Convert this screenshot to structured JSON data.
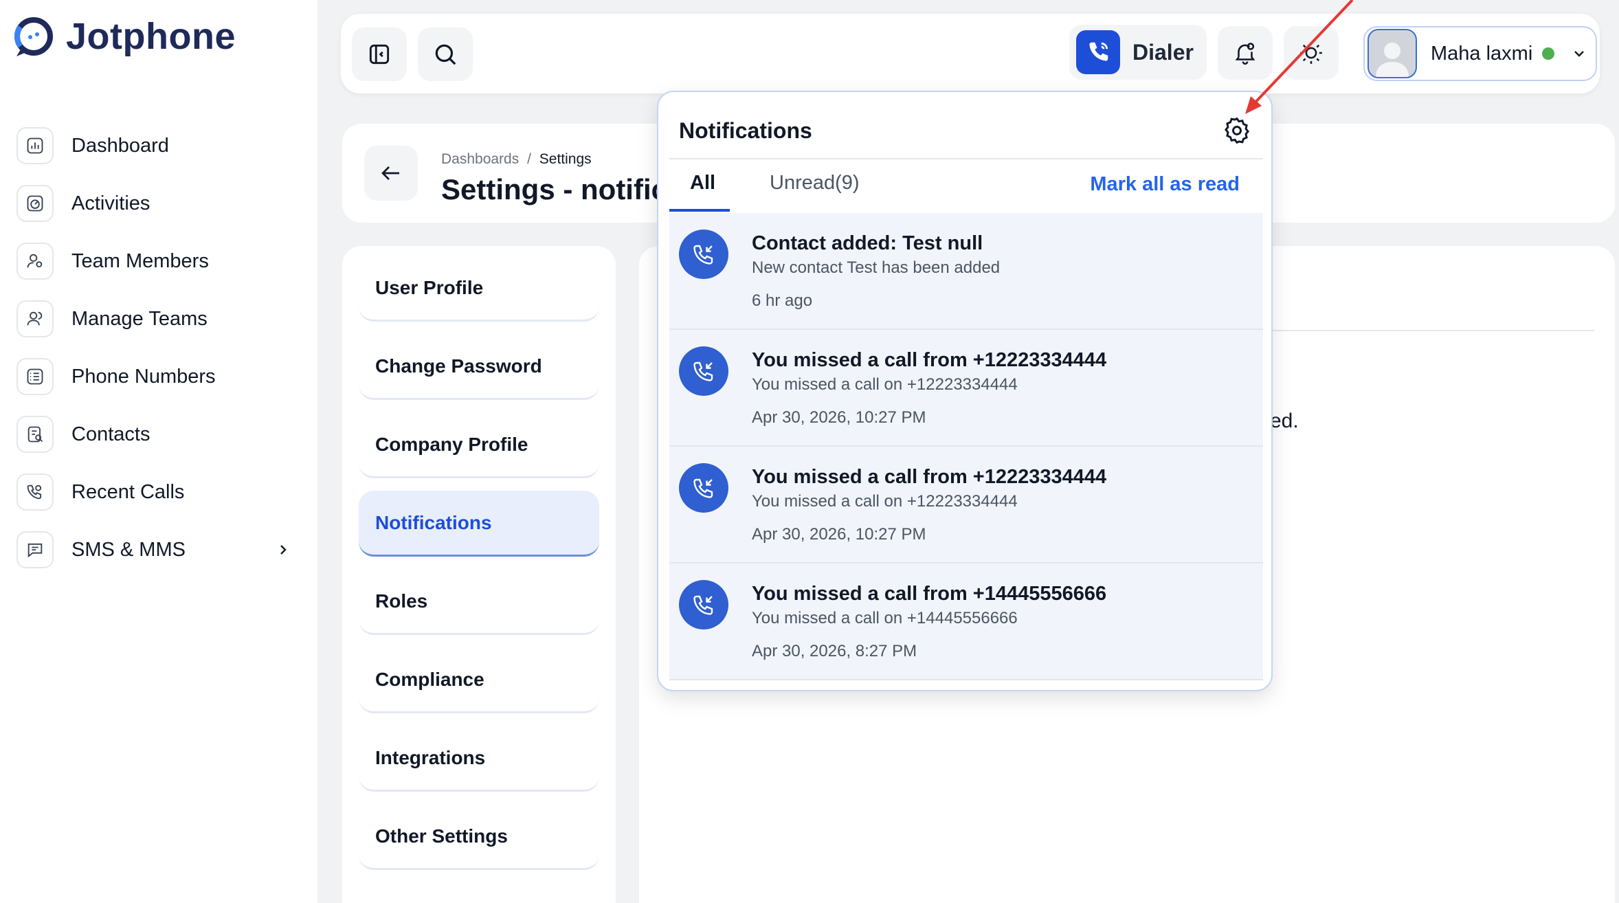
{
  "brand": {
    "name": "Jotphone"
  },
  "sidebar": {
    "items": [
      {
        "label": "Dashboard"
      },
      {
        "label": "Activities"
      },
      {
        "label": "Team Members"
      },
      {
        "label": "Manage Teams"
      },
      {
        "label": "Phone Numbers"
      },
      {
        "label": "Contacts"
      },
      {
        "label": "Recent Calls"
      },
      {
        "label": "SMS & MMS"
      }
    ]
  },
  "topbar": {
    "dialer_label": "Dialer",
    "user_name": "Maha laxmi",
    "status_color": "#4caf50"
  },
  "header": {
    "breadcrumb_root": "Dashboards",
    "breadcrumb_sep": "/",
    "breadcrumb_current": "Settings",
    "title": "Settings - notific"
  },
  "settings_menu": {
    "items": [
      {
        "label": "User Profile"
      },
      {
        "label": "Change Password"
      },
      {
        "label": "Company Profile"
      },
      {
        "label": "Notifications",
        "active": true
      },
      {
        "label": "Roles"
      },
      {
        "label": "Compliance"
      },
      {
        "label": "Integrations"
      },
      {
        "label": "Other Settings"
      }
    ]
  },
  "content": {
    "text_fragment": "ed."
  },
  "notifications": {
    "title": "Notifications",
    "tabs": {
      "all": "All",
      "unread": "Unread(9)"
    },
    "mark_all_label": "Mark all as read",
    "items": [
      {
        "title": "Contact added: Test null",
        "description": "New contact Test has been added",
        "time": "6 hr ago"
      },
      {
        "title": "You missed a call from +12223334444",
        "description": "You missed a call on +12223334444",
        "time": "Apr 30, 2026, 10:27 PM"
      },
      {
        "title": "You missed a call from +12223334444",
        "description": "You missed a call on +12223334444",
        "time": "Apr 30, 2026, 10:27 PM"
      },
      {
        "title": "You missed a call from +14445556666",
        "description": "You missed a call on +14445556666",
        "time": "Apr 30, 2026, 8:27 PM"
      }
    ]
  },
  "colors": {
    "accent": "#1d4ed8",
    "link": "#2563eb",
    "annotation_arrow": "#e53935"
  }
}
